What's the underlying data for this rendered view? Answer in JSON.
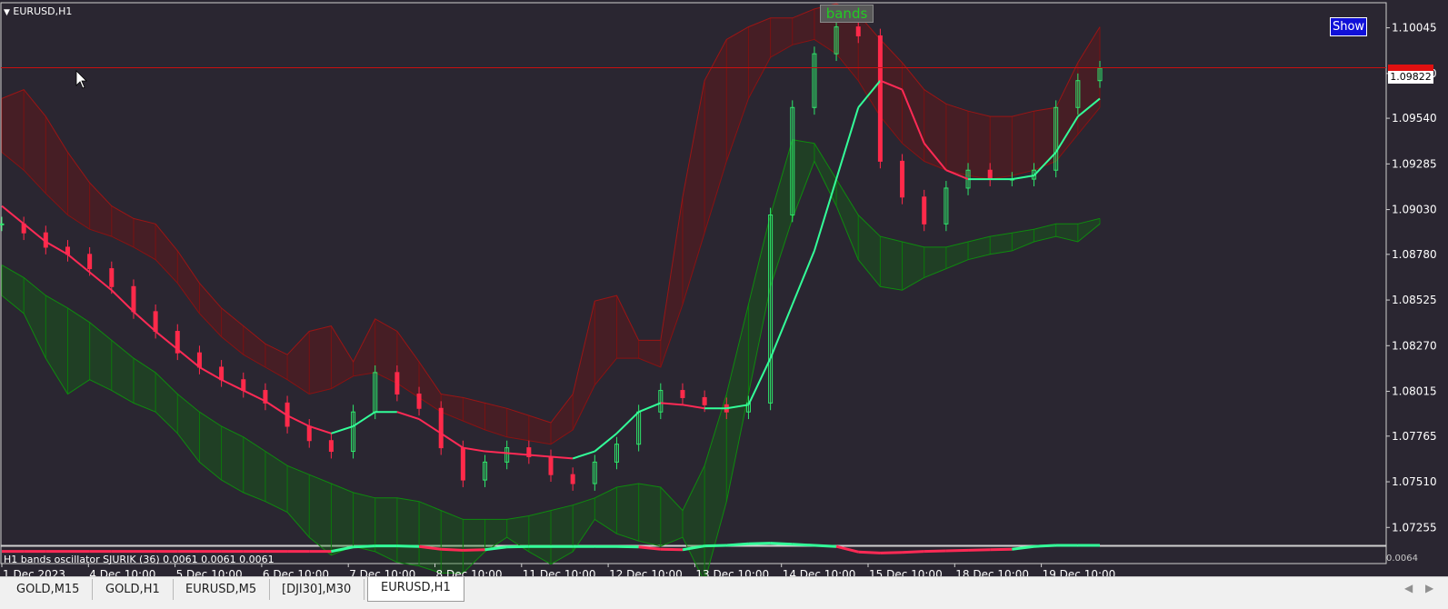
{
  "window": {
    "symbol_label": "EURUSD,H1",
    "show_button": "Show",
    "indicator_label": "bands",
    "oscillator_label": "H1 bands oscillator  SJURIK (36)  0.0061 0.0061 0.0061",
    "current_price": "1.09822",
    "oscillator_axis_value": "0.0064"
  },
  "tabs": [
    {
      "label": "GOLD,M15"
    },
    {
      "label": "GOLD,H1"
    },
    {
      "label": "EURUSD,M5"
    },
    {
      "label": "[DJI30],M30"
    },
    {
      "label": "EURUSD,H1"
    }
  ],
  "colors": {
    "background": "#2a2631",
    "upper_band": "#7a1212",
    "lower_band": "#0b7a0b",
    "middle_down": "#ff2a55",
    "middle_up": "#33ff99",
    "current_price_line": "#c81010"
  },
  "chart_data": {
    "type": "line",
    "title": "EURUSD,H1",
    "y_ticks": [
      1.10045,
      1.0979,
      1.0954,
      1.09285,
      1.0903,
      1.0878,
      1.08525,
      1.0827,
      1.08015,
      1.07765,
      1.0751,
      1.07255
    ],
    "y_tick_labels": [
      "1.10045",
      "1.09790",
      "1.09540",
      "1.09285",
      "1.09030",
      "1.08780",
      "1.08525",
      "1.08270",
      "1.08015",
      "1.07765",
      "1.07510",
      "1.07255"
    ],
    "ylim": [
      1.0716,
      1.1018
    ],
    "x_tick_labels": [
      "1 Dec 2023",
      "4 Dec 10:00",
      "5 Dec 10:00",
      "6 Dec 10:00",
      "7 Dec 10:00",
      "8 Dec 10:00",
      "11 Dec 10:00",
      "12 Dec 10:00",
      "13 Dec 10:00",
      "14 Dec 10:00",
      "15 Dec 10:00",
      "18 Dec 10:00",
      "19 Dec 10:00"
    ],
    "current_price": 1.09822,
    "series": [
      {
        "name": "",
        "role": "price",
        "values": [
          1.0895,
          1.089,
          1.0882,
          1.0878,
          1.087,
          1.086,
          1.0846,
          1.0835,
          1.0823,
          1.0815,
          1.0808,
          1.0802,
          1.0795,
          1.0782,
          1.0774,
          1.0768,
          1.079,
          1.0812,
          1.08,
          1.0792,
          1.077,
          1.0752,
          1.0762,
          1.077,
          1.0765,
          1.0755,
          1.075,
          1.0762,
          1.0772,
          1.079,
          1.0802,
          1.0798,
          1.0794,
          1.079,
          1.0795,
          1.09,
          1.096,
          1.099,
          1.1005,
          1.1,
          1.093,
          1.091,
          1.0895,
          1.0915,
          1.0925,
          1.092,
          1.092,
          1.0925,
          1.096,
          1.0975,
          1.0982
        ]
      },
      {
        "name": "",
        "role": "middle",
        "values": [
          1.0905,
          1.0895,
          1.0885,
          1.0878,
          1.0868,
          1.0858,
          1.0846,
          1.0835,
          1.0825,
          1.0815,
          1.0808,
          1.0802,
          1.0796,
          1.0788,
          1.0782,
          1.0778,
          1.0782,
          1.079,
          1.079,
          1.0786,
          1.0778,
          1.077,
          1.0768,
          1.0767,
          1.0766,
          1.0765,
          1.0764,
          1.0768,
          1.0778,
          1.079,
          1.0795,
          1.0794,
          1.0792,
          1.0792,
          1.0794,
          1.082,
          1.085,
          1.088,
          1.092,
          1.096,
          1.0975,
          1.097,
          1.094,
          1.0925,
          1.092,
          1.092,
          1.092,
          1.0922,
          1.0935,
          1.0955,
          1.0965
        ]
      },
      {
        "name": "",
        "role": "upper_outer",
        "values": [
          1.0965,
          1.097,
          1.0955,
          1.0935,
          1.0918,
          1.0905,
          1.0898,
          1.0895,
          1.088,
          1.0862,
          1.0848,
          1.0838,
          1.0828,
          1.0822,
          1.0835,
          1.0838,
          1.0818,
          1.0842,
          1.0835,
          1.0818,
          1.08,
          1.0798,
          1.0795,
          1.0792,
          1.0788,
          1.0784,
          1.08,
          1.0852,
          1.0855,
          1.083,
          1.083,
          1.091,
          1.0975,
          1.0998,
          1.1005,
          1.101,
          1.101,
          1.1015,
          1.1018,
          1.1012,
          1.0998,
          1.0985,
          1.097,
          1.0962,
          1.0958,
          1.0955,
          1.0955,
          1.0958,
          1.096,
          1.0985,
          1.1005
        ]
      },
      {
        "name": "",
        "role": "upper_inner",
        "values": [
          1.0935,
          1.0925,
          1.0912,
          1.09,
          1.0892,
          1.0888,
          1.0882,
          1.0875,
          1.0862,
          1.0845,
          1.0832,
          1.0822,
          1.0815,
          1.0808,
          1.08,
          1.0803,
          1.081,
          1.0812,
          1.0806,
          1.0798,
          1.079,
          1.0785,
          1.078,
          1.0776,
          1.0774,
          1.0772,
          1.078,
          1.0805,
          1.082,
          1.082,
          1.0815,
          1.085,
          1.089,
          1.093,
          1.0965,
          1.0988,
          1.0995,
          1.0998,
          1.099,
          1.0975,
          1.0955,
          1.094,
          1.093,
          1.0925,
          1.0922,
          1.092,
          1.0922,
          1.0925,
          1.093,
          1.0945,
          1.096
        ]
      },
      {
        "name": "",
        "role": "lower_inner",
        "values": [
          1.0872,
          1.0865,
          1.0855,
          1.0848,
          1.084,
          1.083,
          1.082,
          1.0812,
          1.08,
          1.079,
          1.0782,
          1.0776,
          1.0768,
          1.076,
          1.0755,
          1.075,
          1.0745,
          1.0742,
          1.0742,
          1.074,
          1.0735,
          1.073,
          1.073,
          1.073,
          1.0732,
          1.0735,
          1.0738,
          1.0742,
          1.0748,
          1.075,
          1.0748,
          1.0735,
          1.076,
          1.08,
          1.085,
          1.09,
          1.0942,
          1.094,
          1.092,
          1.09,
          1.0888,
          1.0885,
          1.0882,
          1.0882,
          1.0885,
          1.0888,
          1.089,
          1.0892,
          1.0895,
          1.0895,
          1.0898
        ]
      },
      {
        "name": "",
        "role": "lower_outer",
        "values": [
          1.0855,
          1.0845,
          1.082,
          1.08,
          1.0808,
          1.0802,
          1.0795,
          1.079,
          1.0778,
          1.0762,
          1.0752,
          1.0745,
          1.074,
          1.0734,
          1.072,
          1.071,
          1.0715,
          1.0712,
          1.0706,
          1.0704,
          1.07,
          1.07,
          1.0712,
          1.072,
          1.0712,
          1.0705,
          1.0712,
          1.073,
          1.0722,
          1.0718,
          1.0715,
          1.072,
          1.0695,
          1.074,
          1.08,
          1.086,
          1.0898,
          1.093,
          1.0905,
          1.0875,
          1.086,
          1.0858,
          1.0865,
          1.087,
          1.0875,
          1.0878,
          1.088,
          1.0885,
          1.0888,
          1.0885,
          1.0895
        ]
      },
      {
        "name": "",
        "role": "oscillator",
        "values": [
          -0.6,
          -0.6,
          -0.6,
          -0.6,
          -0.6,
          -0.6,
          -0.6,
          -0.6,
          -0.6,
          -0.6,
          -0.6,
          -0.6,
          -0.6,
          -0.6,
          -0.6,
          -0.6,
          0.2,
          0.4,
          0.4,
          0.3,
          -0.2,
          -0.4,
          -0.3,
          0.2,
          0.3,
          0.3,
          0.3,
          0.3,
          0.3,
          0.2,
          -0.2,
          -0.3,
          0.4,
          0.5,
          0.8,
          0.9,
          0.7,
          0.5,
          0.3,
          -0.7,
          -0.9,
          -0.8,
          -0.6,
          -0.5,
          -0.4,
          -0.3,
          -0.2,
          0.3,
          0.5,
          0.5,
          0.5
        ]
      }
    ]
  }
}
